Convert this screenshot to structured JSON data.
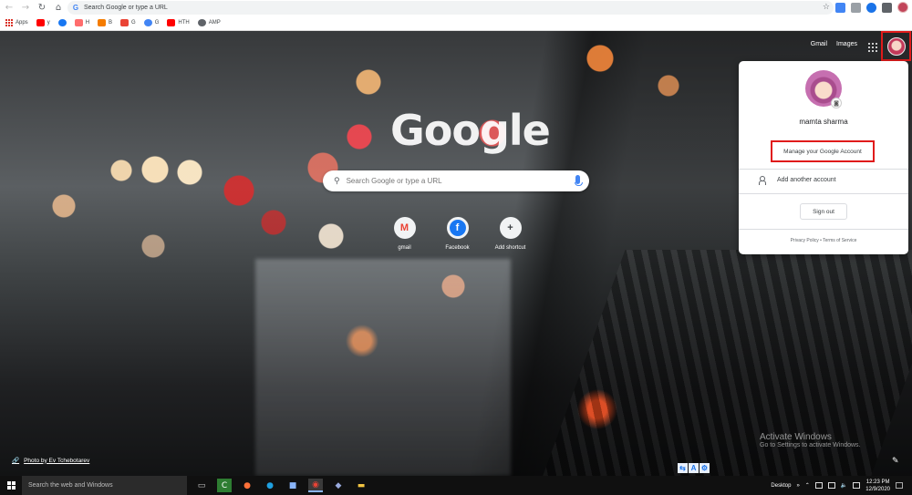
{
  "browser": {
    "omnibox_placeholder": "Search Google or type a URL",
    "bookmarks": [
      {
        "label": "Apps",
        "color": "#d93025"
      },
      {
        "label": "y",
        "color": "#ff0000"
      },
      {
        "label": "",
        "color": "#1877f2"
      },
      {
        "label": "H",
        "color": "#ff6d6d"
      },
      {
        "label": "B",
        "color": "#f57c00"
      },
      {
        "label": "G",
        "color": "#ea4335"
      },
      {
        "label": "G",
        "color": "#4285f4"
      },
      {
        "label": "HTH",
        "color": "#ff0000"
      },
      {
        "label": "AMP",
        "color": "#5f6368"
      }
    ]
  },
  "ntp": {
    "links": {
      "gmail": "Gmail",
      "images": "Images"
    },
    "logo": "Google",
    "search_placeholder": "Search Google or type a URL",
    "shortcuts": [
      {
        "label": "gmail",
        "icon": "M",
        "color": "#ea4335"
      },
      {
        "label": "Facebook",
        "icon": "f",
        "color": "#1877f2"
      },
      {
        "label": "Add shortcut",
        "icon": "+",
        "color": "#3c4043"
      }
    ],
    "photo_credit": "Photo by Ev Tchebotarev",
    "link_icon": "🔗",
    "watermark_title": "Activate Windows",
    "watermark_sub": "Go to Settings to activate Windows."
  },
  "account_popup": {
    "name": "mamta sharma",
    "manage_label": "Manage your Google Account",
    "add_account_label": "Add another account",
    "signout_label": "Sign out",
    "legal": "Privacy Policy  •  Terms of Service"
  },
  "taskbar": {
    "search_placeholder": "Search the web and Windows",
    "desktop_label": "Desktop",
    "time": "12:23 PM",
    "date": "12/9/2020"
  }
}
